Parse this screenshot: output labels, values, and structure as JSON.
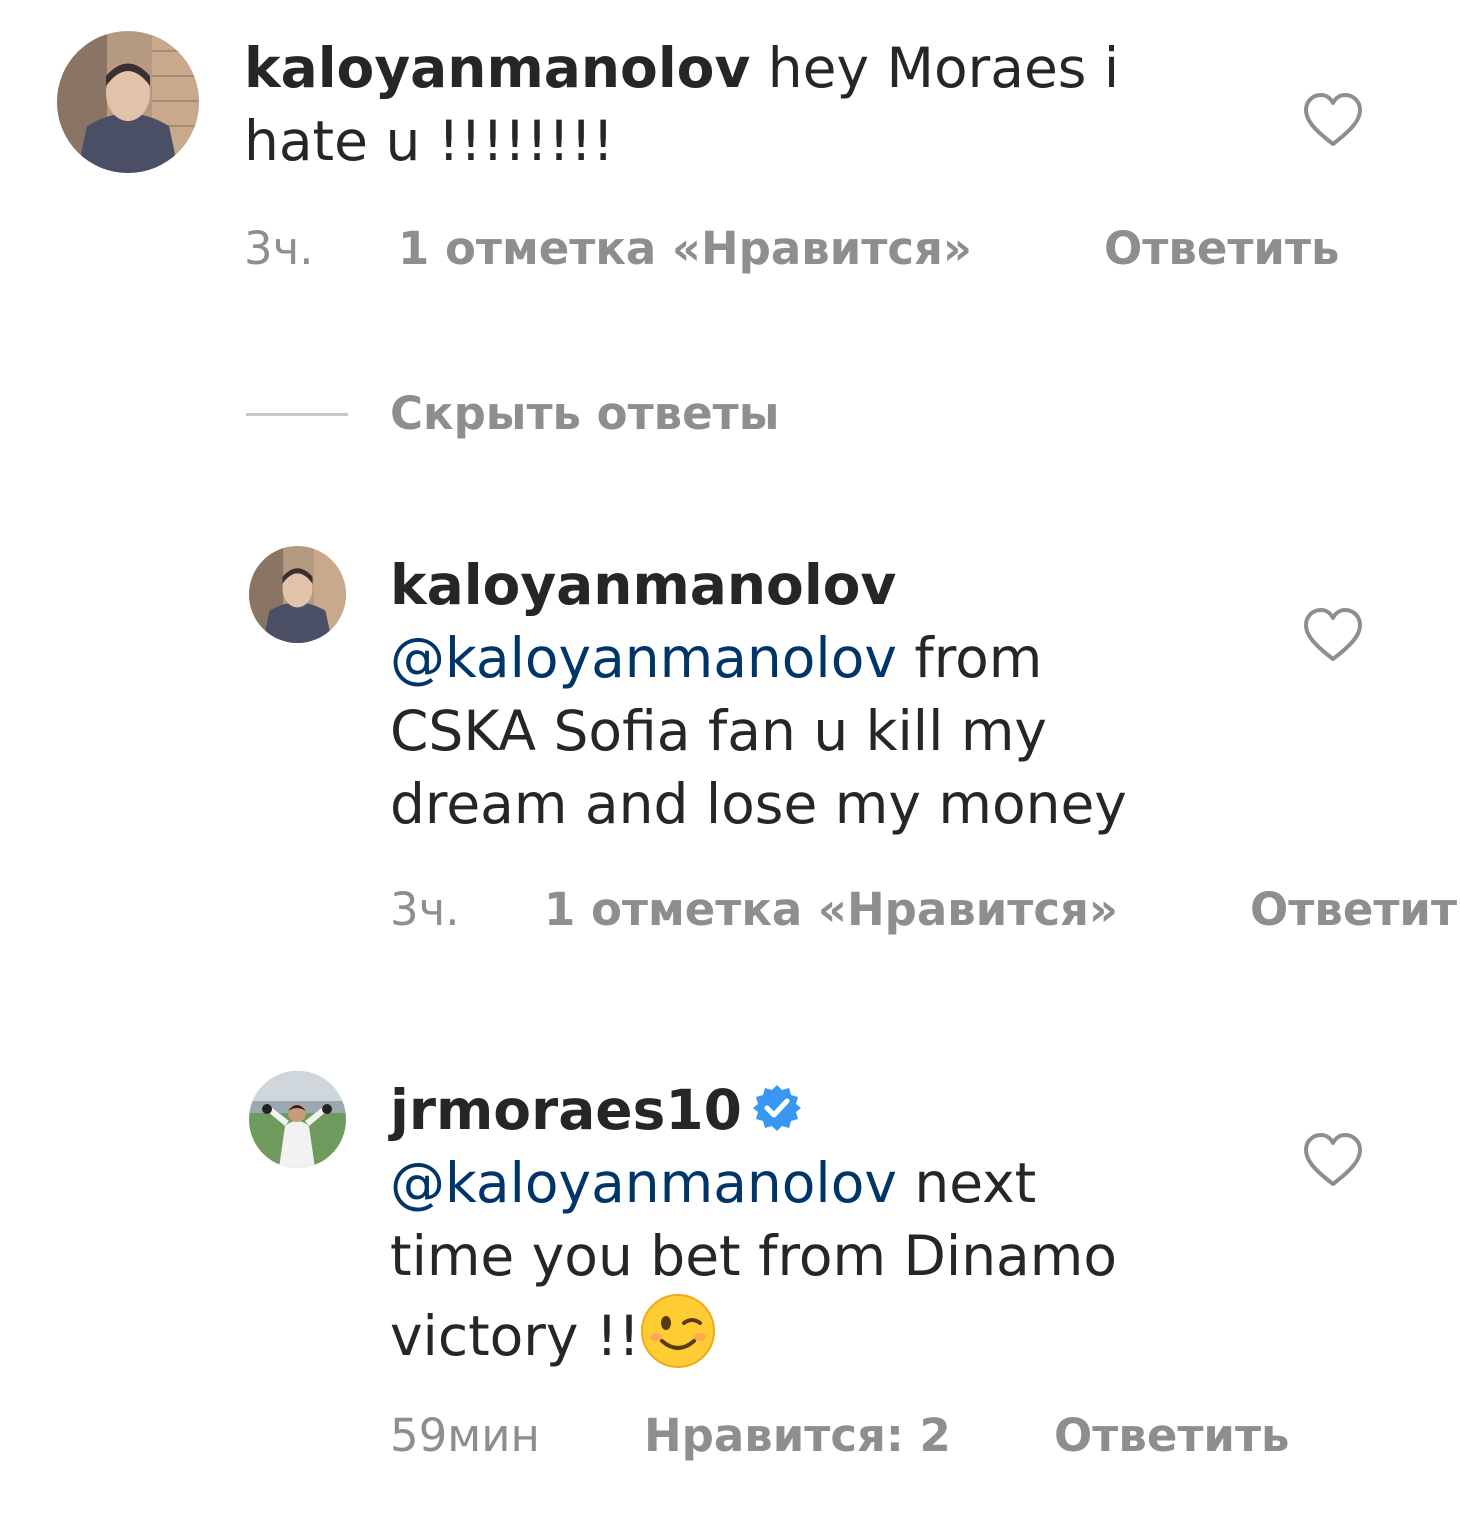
{
  "comments": [
    {
      "username": "kaloyanmanolov",
      "text_prefix": " hey Moraes i",
      "text_line2": "hate u !!!!!!!!",
      "time": "3ч.",
      "likes": "1 отметка «Нравится»",
      "reply": "Ответить"
    }
  ],
  "hide_replies": "Скрыть ответы",
  "replies": [
    {
      "username": "kaloyanmanolov",
      "mention": "@kaloyanmanolov",
      "text_line1_rest": " from",
      "text_line2": "CSKA Sofia fan u kill my",
      "text_line3": "dream and lose my money",
      "time": "3ч.",
      "likes": "1 отметка «Нравится»",
      "reply": "Ответить"
    },
    {
      "username": "jrmoraes10",
      "verified": true,
      "mention": "@kaloyanmanolov",
      "text_line1_rest": " next",
      "text_line2": "time you bet from Dinamo",
      "text_line3": "victory !!",
      "emoji": "winking-face",
      "time": "59мин",
      "likes": "Нравится: 2",
      "reply": "Ответить"
    }
  ],
  "colors": {
    "text": "#262626",
    "meta": "#8e8e8e",
    "mention": "#003569",
    "verified": "#3897f0"
  }
}
